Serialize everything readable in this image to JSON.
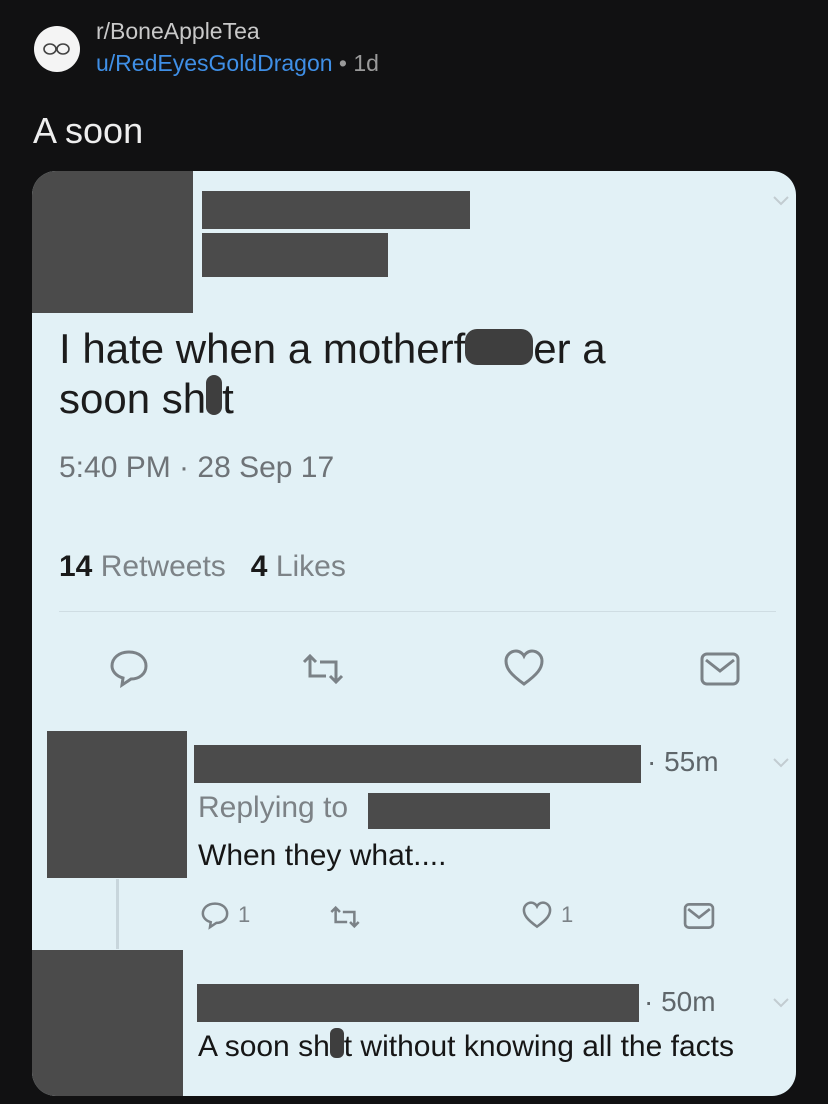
{
  "post": {
    "subreddit": "r/BoneAppleTea",
    "author": "u/RedEyesGoldDragon",
    "separator": "•",
    "age": "1d",
    "title": "A soon"
  },
  "tweet": {
    "text_part1": "I hate when a motherf",
    "text_part2": "er a",
    "text_line2_part1": "soon sh",
    "text_line2_part2": "t",
    "timestamp": "5:40 PM · 28 Sep 17",
    "retweets_count": "14",
    "retweets_label": "Retweets",
    "likes_count": "4",
    "likes_label": "Likes"
  },
  "reply1": {
    "time": "· 55m",
    "replying_to": "Replying to",
    "body": "When they what....",
    "reply_count": "1",
    "like_count": "1"
  },
  "reply2": {
    "time": "· 50m",
    "body_part1": "A soon sh",
    "body_part2": "t without knowing all the facts"
  },
  "icons": {
    "reply": "speech-bubble-icon",
    "retweet": "retweet-icon",
    "like": "heart-icon",
    "dm": "envelope-icon",
    "chevron": "chevron-down-icon"
  },
  "colors": {
    "background": "#111112",
    "card": "#e2f1f6",
    "redaction": "#4b4b4b",
    "author_link": "#3f8fe6"
  }
}
